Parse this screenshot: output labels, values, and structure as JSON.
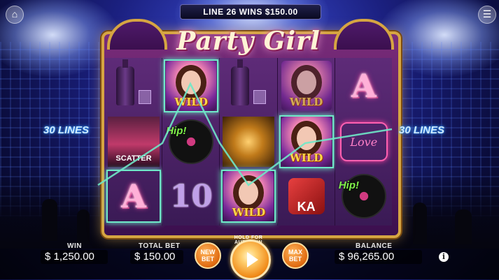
{
  "game": {
    "title": "Party Girl"
  },
  "banner": {
    "text": "LINE 26 WINS $150.00"
  },
  "side_labels": {
    "left": "30 LINES",
    "right": "30 LINES"
  },
  "reels": [
    [
      {
        "symbol": "bottle-glass",
        "highlighted": false
      },
      {
        "symbol": "scatter",
        "label": "SCATTER",
        "highlighted": false
      },
      {
        "symbol": "letter-a",
        "label": "A",
        "highlighted": true
      }
    ],
    [
      {
        "symbol": "wild",
        "label": "WILD",
        "highlighted": true
      },
      {
        "symbol": "vinyl",
        "label": "Hip!",
        "highlighted": false
      },
      {
        "symbol": "ten",
        "label": "10",
        "highlighted": false
      }
    ],
    [
      {
        "symbol": "bottle-glass",
        "highlighted": false
      },
      {
        "symbol": "disco-ball",
        "highlighted": false
      },
      {
        "symbol": "wild",
        "label": "WILD",
        "highlighted": true
      }
    ],
    [
      {
        "symbol": "wild",
        "label": "WILD",
        "highlighted": false
      },
      {
        "symbol": "wild",
        "label": "WILD",
        "highlighted": true
      },
      {
        "symbol": "dice",
        "label": "KA",
        "highlighted": false
      }
    ],
    [
      {
        "symbol": "letter-a",
        "label": "A",
        "highlighted": false
      },
      {
        "symbol": "heart",
        "label": "Love",
        "highlighted": false
      },
      {
        "symbol": "vinyl",
        "label": "Hip!",
        "highlighted": false
      }
    ]
  ],
  "bottom": {
    "win_label": "WIN",
    "win_value": "$ 1,250.00",
    "total_bet_label": "TOTAL BET",
    "total_bet_value": "$ 150.00",
    "new_bet_label": "NEW BET",
    "spin_hint": "HOLD FOR AUTOSPIN",
    "max_bet_label": "MAX BET",
    "balance_label": "BALANCE",
    "balance_value": "$ 96,265.00",
    "info_label": "i"
  },
  "colors": {
    "payline": "#6fe8c8",
    "frame_gold": "#d6a542",
    "accent_orange": "#f08a18"
  }
}
